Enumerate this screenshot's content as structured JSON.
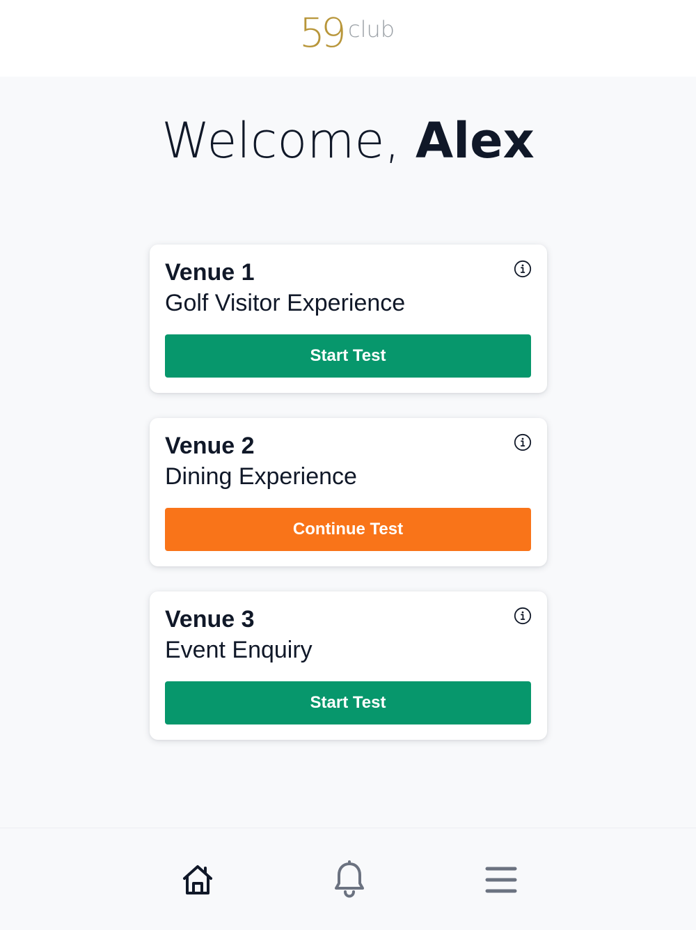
{
  "header": {
    "logo": {
      "number": "59",
      "word": "club",
      "number_color": "#b8963a",
      "word_color": "#9aa0a6"
    }
  },
  "welcome": {
    "greeting": "Welcome, ",
    "name": "Alex"
  },
  "cards": [
    {
      "title": "Venue 1",
      "subtitle": "Golf Visitor Experience",
      "button_label": "Start Test",
      "button_color": "#07976c",
      "info_icon": "info-icon"
    },
    {
      "title": "Venue 2",
      "subtitle": "Dining Experience",
      "button_label": "Continue Test",
      "button_color": "#f97419",
      "info_icon": "info-icon"
    },
    {
      "title": "Venue 3",
      "subtitle": "Event Enquiry",
      "button_label": "Start Test",
      "button_color": "#07976c",
      "info_icon": "info-icon"
    }
  ],
  "bottom_nav": {
    "items": [
      {
        "icon": "home-icon",
        "active": true
      },
      {
        "icon": "bell-icon",
        "active": false
      },
      {
        "icon": "menu-icon",
        "active": false
      }
    ],
    "active_color": "#101828",
    "inactive_color": "#6b7280"
  }
}
